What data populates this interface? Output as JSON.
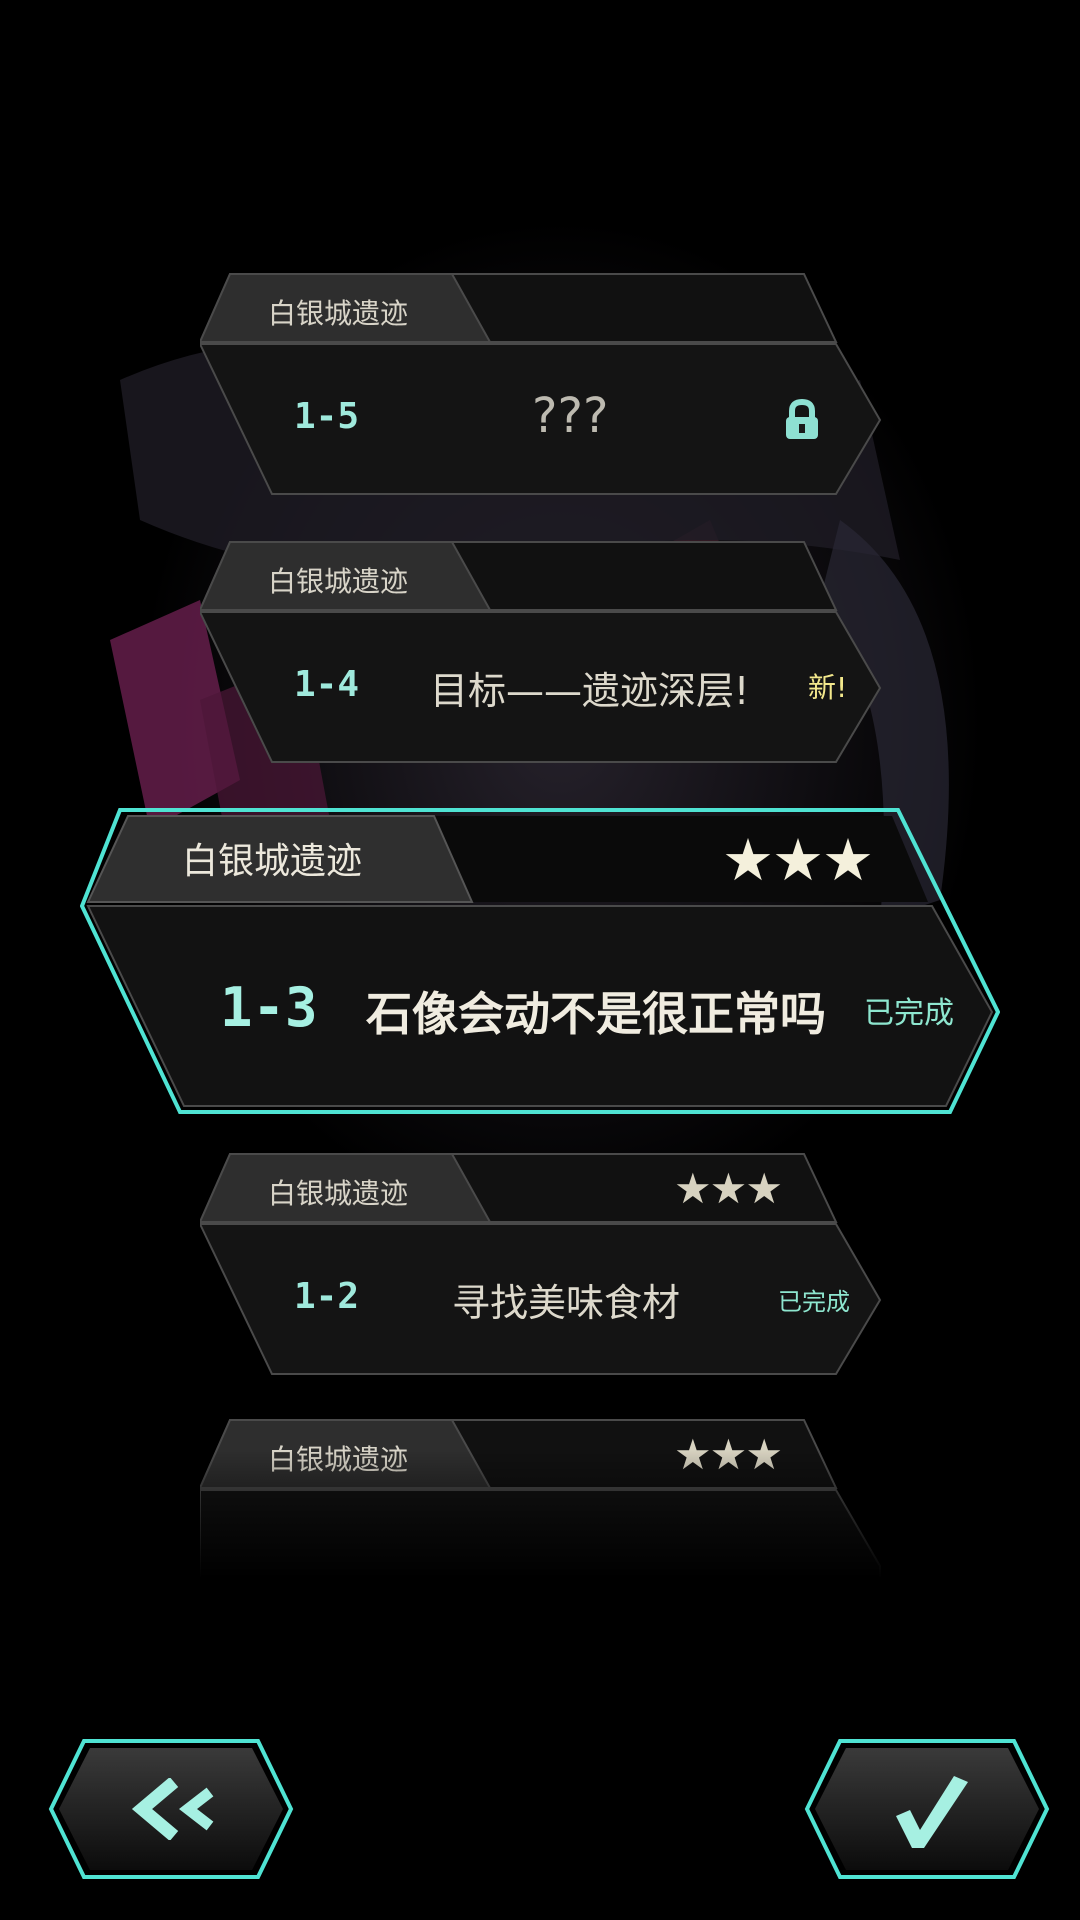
{
  "stages": [
    {
      "region": "白银城遗迹",
      "code": "1-5",
      "title": "???",
      "status": "",
      "stars": 0,
      "locked": true,
      "selected": false
    },
    {
      "region": "白银城遗迹",
      "code": "1-4",
      "title": "目标——遗迹深层!",
      "status": "新!",
      "stars": 0,
      "locked": false,
      "selected": false
    },
    {
      "region": "白银城遗迹",
      "code": "1-3",
      "title": "石像会动不是很正常吗",
      "status": "已完成",
      "stars": 3,
      "locked": false,
      "selected": true
    },
    {
      "region": "白银城遗迹",
      "code": "1-2",
      "title": "寻找美味食材",
      "status": "已完成",
      "stars": 3,
      "locked": false,
      "selected": false
    },
    {
      "region": "白银城遗迹",
      "code": "",
      "title": "",
      "status": "",
      "stars": 3,
      "locked": false,
      "selected": false
    }
  ],
  "nav": {
    "back_icon": "double-chevron-left-icon",
    "confirm_icon": "checkmark-icon"
  },
  "colors": {
    "accent": "#4fe3d3",
    "star": "#f4f0dc",
    "star_dim": "#d7d2c0",
    "new": "#f3e88c"
  }
}
